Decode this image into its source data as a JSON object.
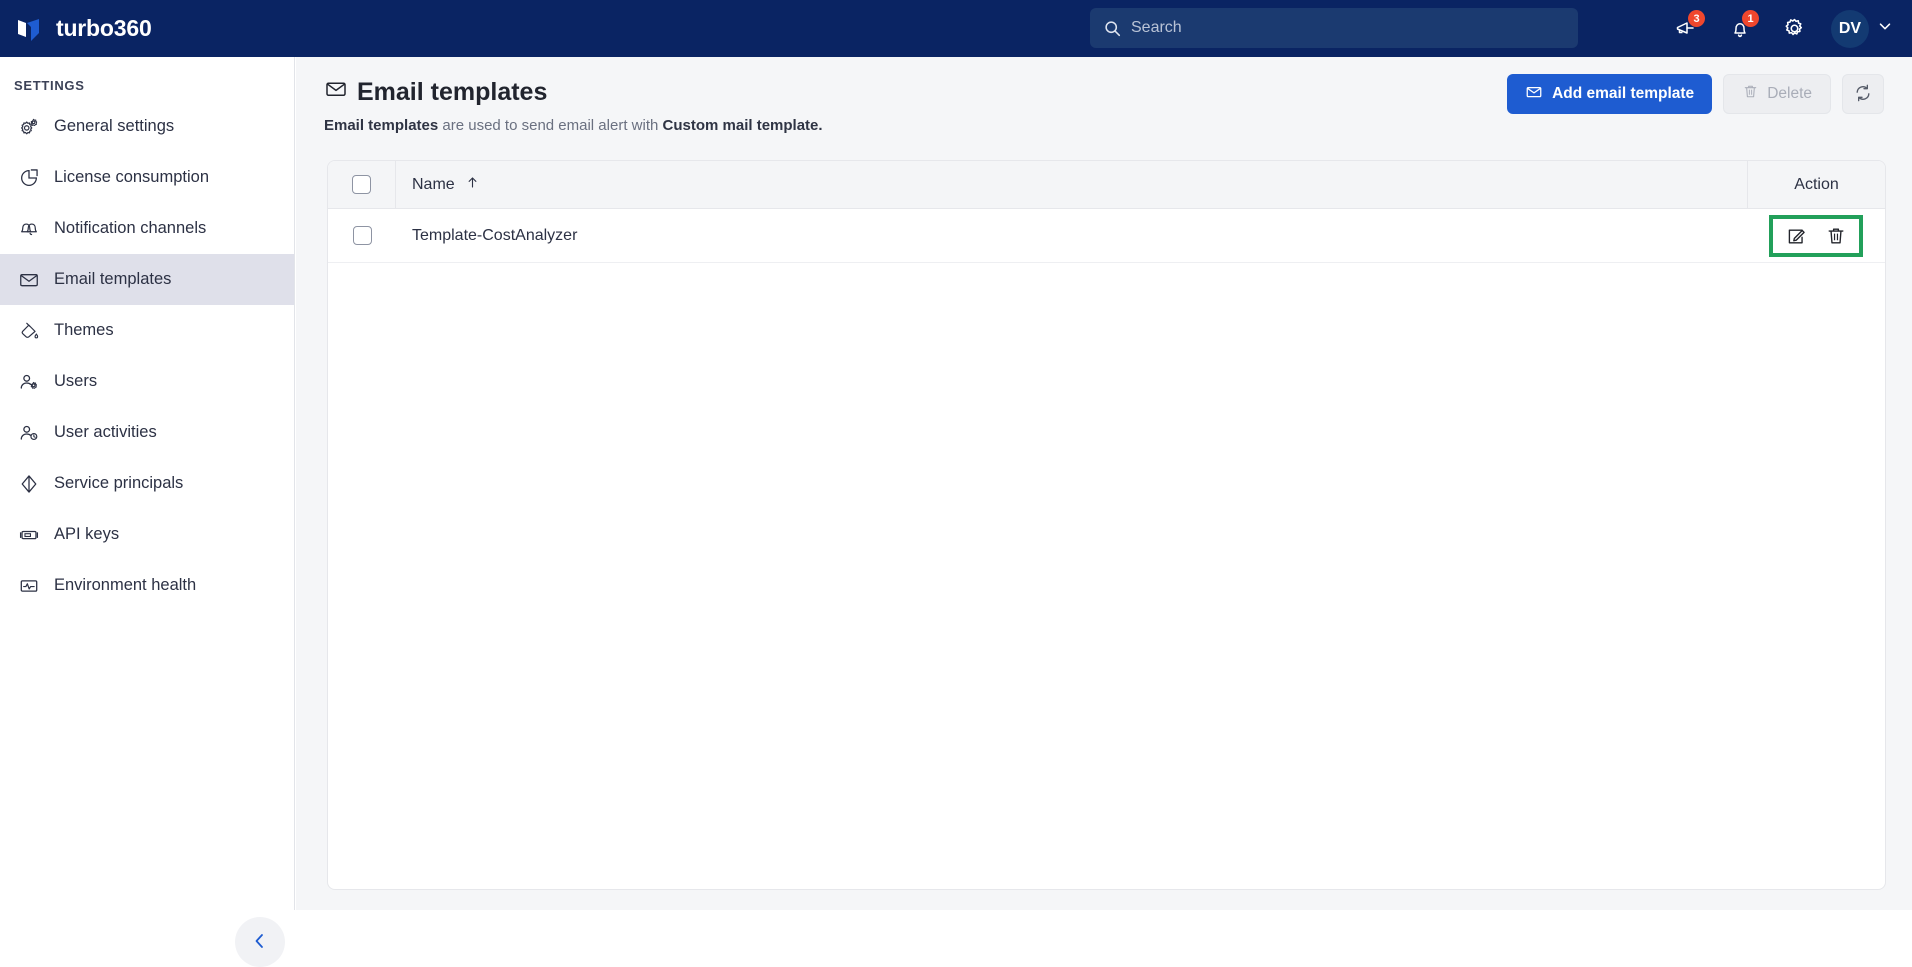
{
  "app": {
    "brand": "turbo360",
    "logo_icon": "turbo360-logo-icon"
  },
  "topbar": {
    "search": {
      "placeholder": "Search",
      "value": "",
      "icon": "search-icon"
    },
    "announcements": {
      "icon": "megaphone-icon",
      "badge": "3"
    },
    "notifications": {
      "icon": "bell-icon",
      "badge": "1"
    },
    "settings": {
      "icon": "gear-icon"
    },
    "user": {
      "initials": "DV",
      "chevron_icon": "chevron-down-icon"
    }
  },
  "sidebar": {
    "section_title": "SETTINGS",
    "items": [
      {
        "label": "General settings",
        "icon": "gears-icon",
        "active": false
      },
      {
        "label": "License consumption",
        "icon": "pie-chart-icon",
        "active": false
      },
      {
        "label": "Notification channels",
        "icon": "bells-icon",
        "active": false
      },
      {
        "label": "Email templates",
        "icon": "envelope-icon",
        "active": true
      },
      {
        "label": "Themes",
        "icon": "paint-bucket-icon",
        "active": false
      },
      {
        "label": "Users",
        "icon": "user-gear-icon",
        "active": false
      },
      {
        "label": "User activities",
        "icon": "user-clock-icon",
        "active": false
      },
      {
        "label": "Service principals",
        "icon": "diamond-icon",
        "active": false
      },
      {
        "label": "API keys",
        "icon": "key-card-icon",
        "active": false
      },
      {
        "label": "Environment health",
        "icon": "health-monitor-icon",
        "active": false
      }
    ],
    "collapse": {
      "icon": "chevron-left-icon"
    }
  },
  "page": {
    "title": "Email templates",
    "title_icon": "envelope-icon",
    "subtitle_lead": "Email templates",
    "subtitle_mid": " are used to send email alert with ",
    "subtitle_strong": "Custom mail template."
  },
  "toolbar": {
    "add_label": "Add email template",
    "add_icon": "envelope-icon",
    "delete_label": "Delete",
    "delete_icon": "trash-icon",
    "delete_disabled": true,
    "refresh_icon": "refresh-icon"
  },
  "table": {
    "columns": [
      "Name",
      "Action"
    ],
    "sort": {
      "column": "Name",
      "direction": "asc",
      "icon": "arrow-up-icon"
    },
    "select_all_checked": false,
    "rows": [
      {
        "selected": false,
        "name": "Template-CostAnalyzer",
        "actions": [
          "edit-icon",
          "delete-icon"
        ]
      }
    ]
  },
  "annotation": {
    "highlight_color": "#22a05a",
    "target": "row-action-buttons"
  },
  "colors": {
    "topbar_bg": "#0a2463",
    "primary": "#1e5cd1",
    "badge": "#f0472d",
    "sidebar_active": "#dfe0ea",
    "main_bg": "#f5f6f8"
  }
}
